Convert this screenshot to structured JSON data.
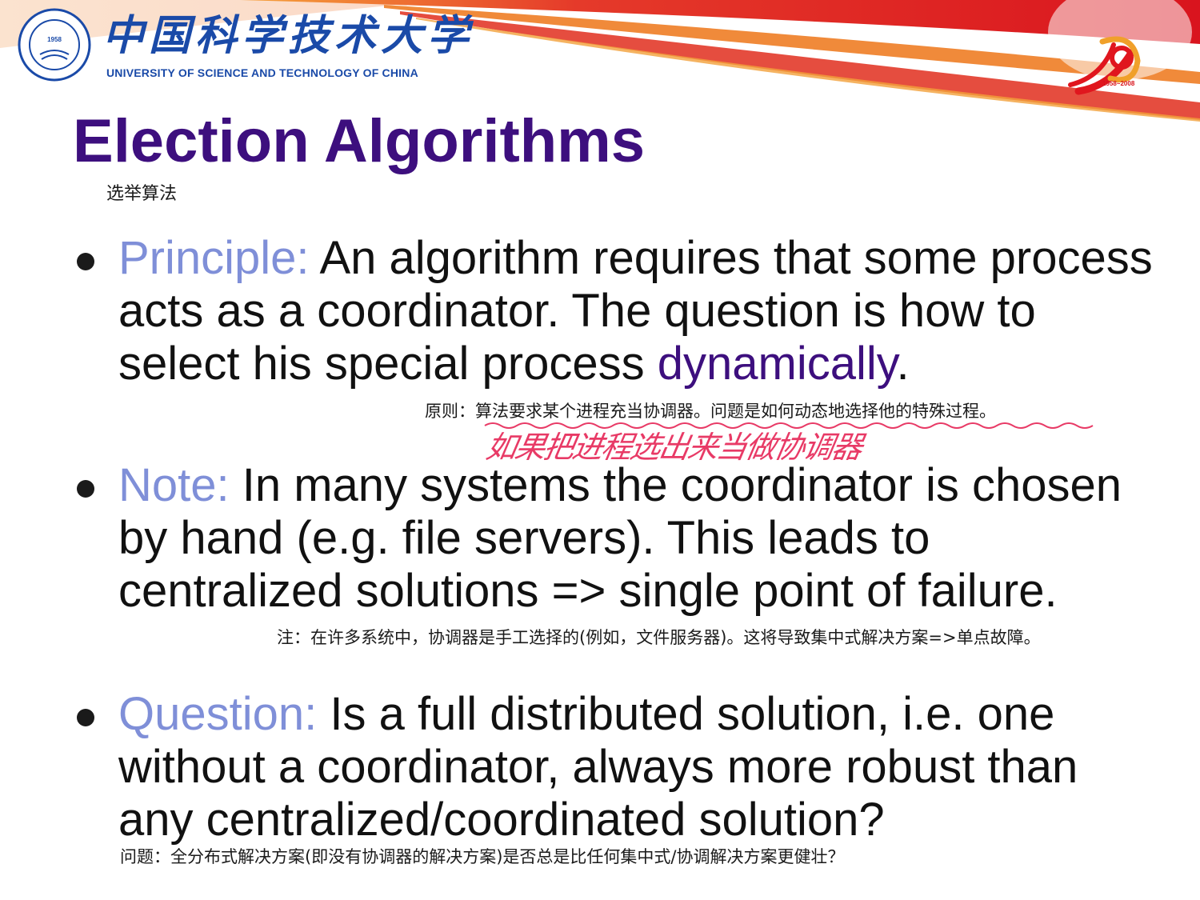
{
  "header": {
    "university_cn": "中国科学技术大学",
    "university_en": "UNIVERSITY OF SCIENCE AND TECHNOLOGY OF CHINA",
    "seal_year": "1958",
    "anniversary_years": "1958~2008",
    "colors": {
      "banner_red": "#e53a2a",
      "logo_blue": "#1a4aa8"
    }
  },
  "slide": {
    "title": "Election Algorithms",
    "subtitle_cn": "选举算法",
    "colors": {
      "title": "#3d0f7e",
      "lead": "#7f8fd8"
    }
  },
  "bullets": [
    {
      "lead": "Principle:",
      "text": " An algorithm requires that some process acts as a coordinator. The question is how to select his special process ",
      "emph": "dynamically",
      "tail": ".",
      "annotation_cn": "原则：算法要求某个进程充当协调器。问题是如何动态地选择他的特殊过程。",
      "handwritten_note": "如果把进程选出来当做协调器"
    },
    {
      "lead": "Note:",
      "text": " In many systems the coordinator is chosen by hand (e.g. file servers). This leads to centralized solutions => single point of failure.",
      "annotation_cn": "注：在许多系统中，协调器是手工选择的(例如，文件服务器)。这将导致集中式解决方案=>单点故障。"
    },
    {
      "lead": "Question:",
      "text": " Is a full distributed solution, i.e. one without a coordinator, always more robust than any centralized/coordinated solution?",
      "annotation_cn": "问题：全分布式解决方案(即没有协调器的解决方案)是否总是比任何集中式/协调解决方案更健壮？"
    }
  ]
}
